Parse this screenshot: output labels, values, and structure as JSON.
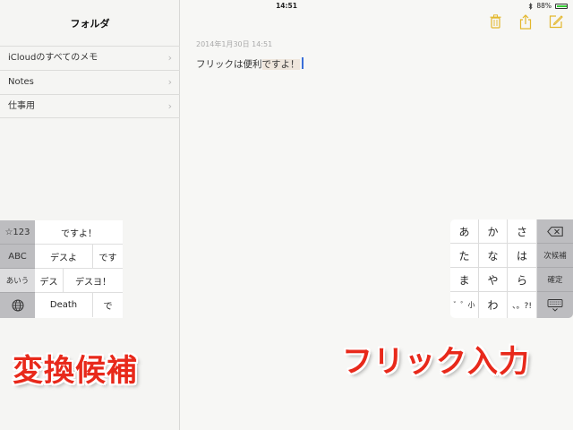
{
  "status_bar": {
    "device": "iPad",
    "time": "14:51",
    "battery": "88%",
    "battery_level": 0.88
  },
  "sidebar": {
    "title": "フォルダ",
    "folders": [
      {
        "label": "iCloudのすべてのメモ"
      },
      {
        "label": "Notes"
      },
      {
        "label": "仕事用"
      }
    ]
  },
  "note": {
    "date": "2014年1月30日 14:51",
    "text_plain": "フリックは便利",
    "text_marked": "ですよ！"
  },
  "toolbar": {
    "icons": [
      "trash-icon",
      "share-icon",
      "compose-icon"
    ],
    "accent_color": "#e3b72c"
  },
  "candidate_keyboard": {
    "side_keys": [
      "☆123",
      "ABC",
      "あいう",
      ""
    ],
    "rows": [
      [
        "ですよ！"
      ],
      [
        "デスよ",
        "です"
      ],
      [
        "デス",
        "デスヨ！"
      ],
      [
        "Death",
        "で"
      ]
    ]
  },
  "flick_keyboard": {
    "keys": [
      [
        "あ",
        "か",
        "さ"
      ],
      [
        "た",
        "な",
        "は"
      ],
      [
        "ま",
        "や",
        "ら"
      ],
      [
        "゛゜小",
        "わ",
        "、。?!"
      ]
    ],
    "function_keys": [
      "",
      "次候補",
      "確定",
      ""
    ]
  },
  "captions": {
    "left": "変換候補",
    "right": "フリック入力",
    "color": "#e8291b"
  }
}
